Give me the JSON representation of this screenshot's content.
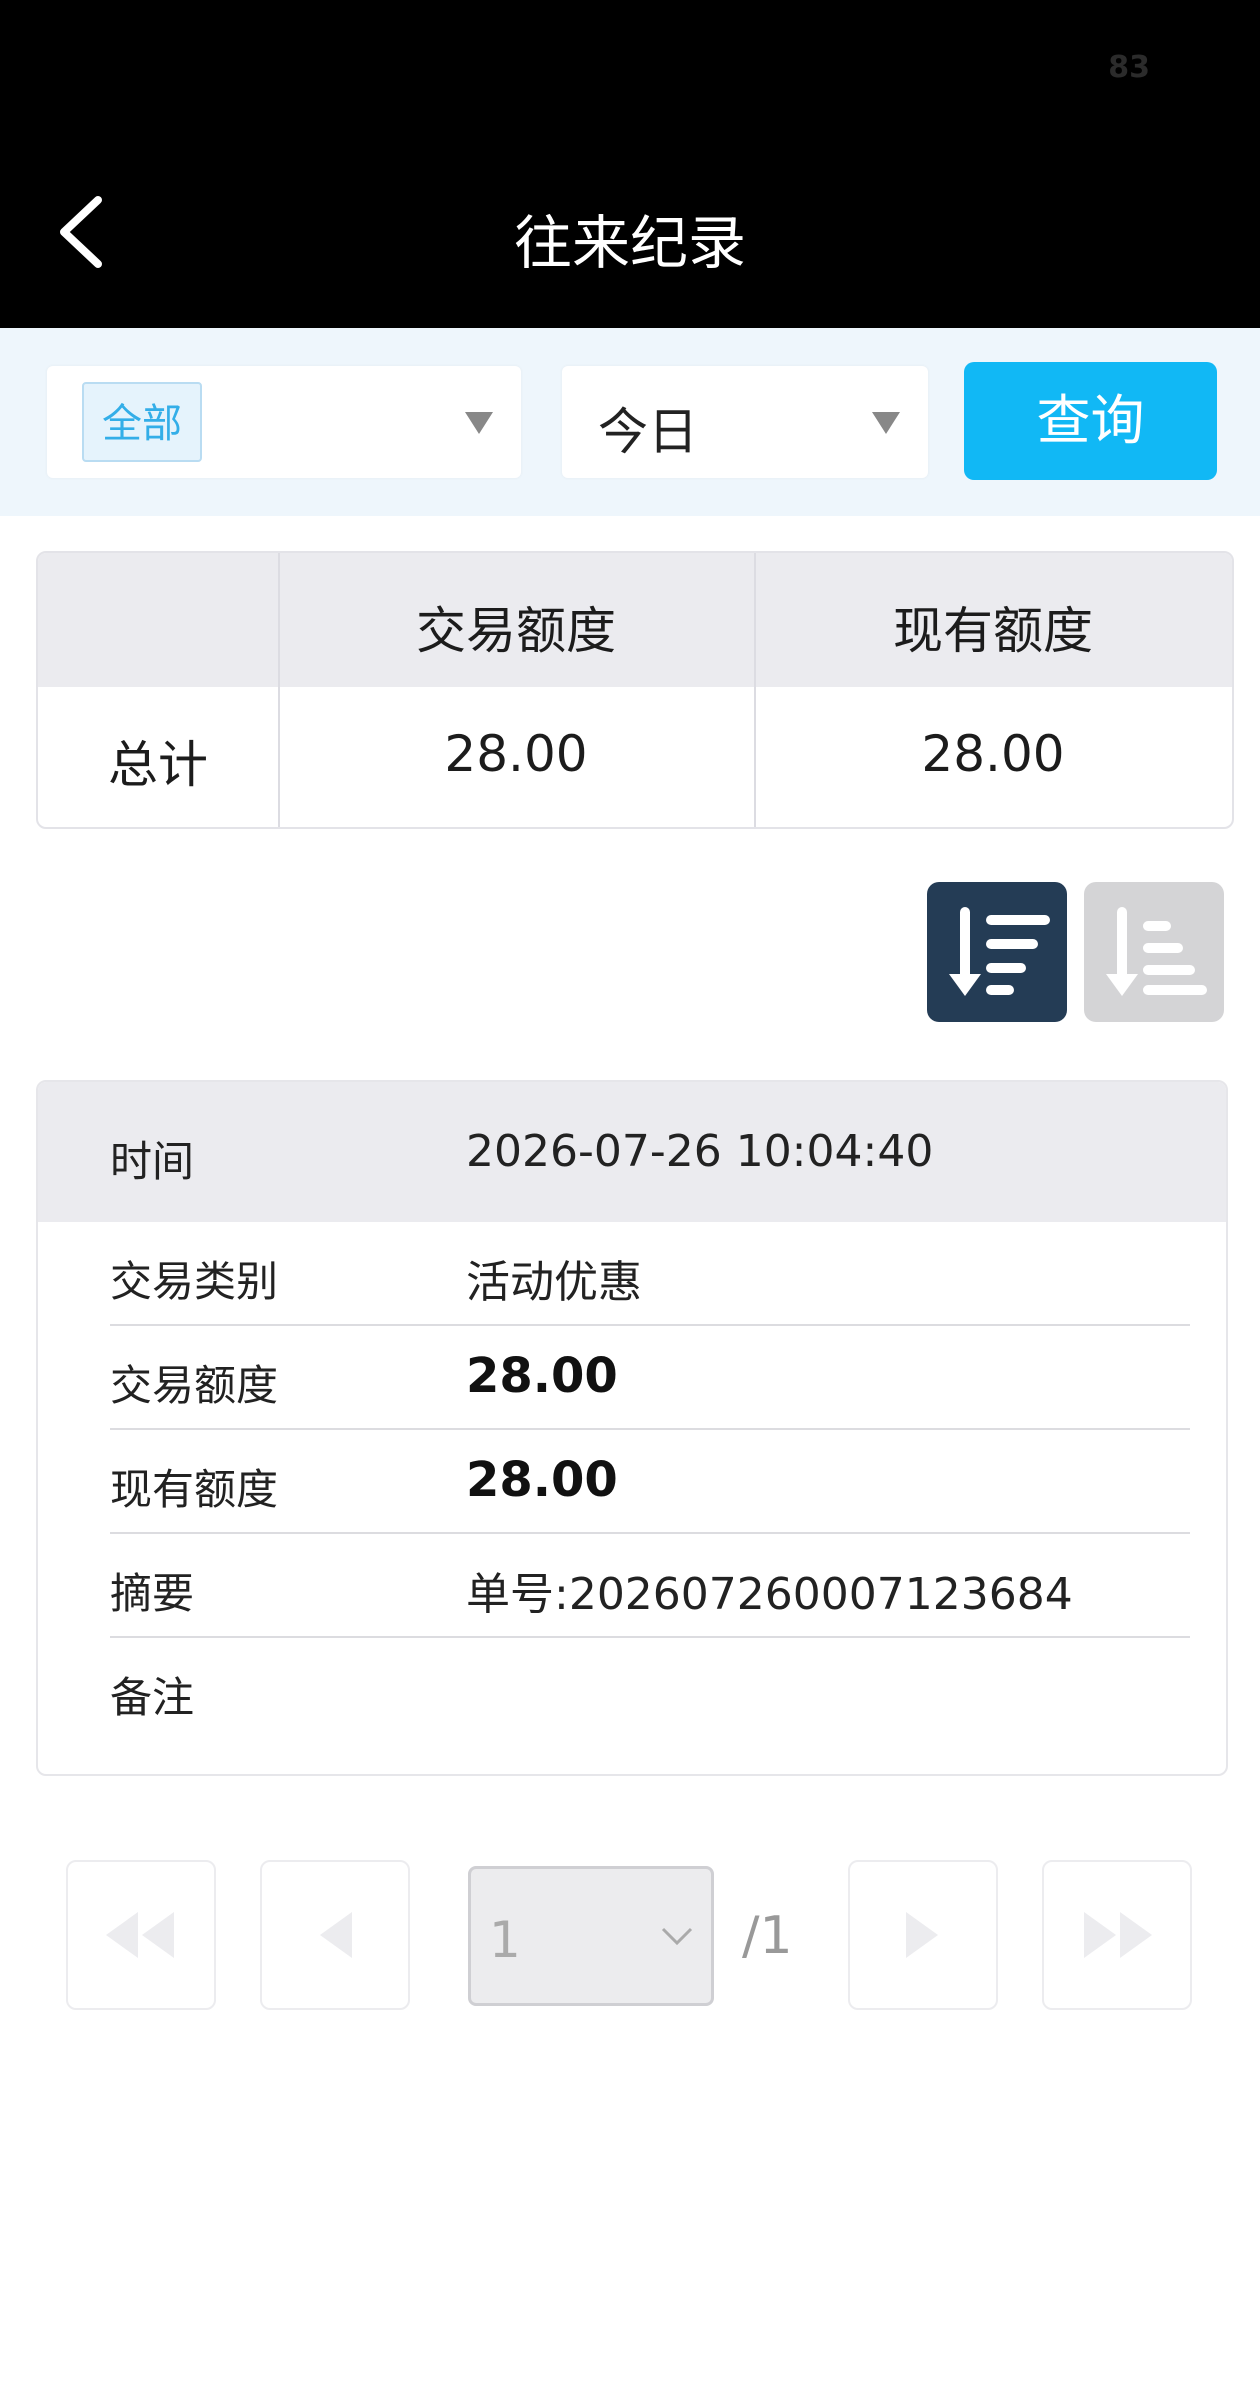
{
  "status_bar": {
    "battery": "83"
  },
  "header": {
    "title": "往来纪录"
  },
  "filters": {
    "category_tag": "全部",
    "date_range": "今日",
    "query_label": "查询"
  },
  "summary": {
    "columns": [
      "",
      "交易额度",
      "现有额度"
    ],
    "row_label": "总计",
    "transaction_amount": "28.00",
    "balance": "28.00"
  },
  "record": {
    "time_label": "时间",
    "time_value": "2026-07-26 10:04:40",
    "type_label": "交易类别",
    "type_value": "活动优惠",
    "amount_label": "交易额度",
    "amount_value": "28.00",
    "balance_label": "现有额度",
    "balance_value": "28.00",
    "summary_label": "摘要",
    "summary_value": "单号:20260726000712368​4",
    "remark_label": "备注",
    "remark_value": ""
  },
  "pagination": {
    "current_page": "1",
    "total": "/1"
  }
}
